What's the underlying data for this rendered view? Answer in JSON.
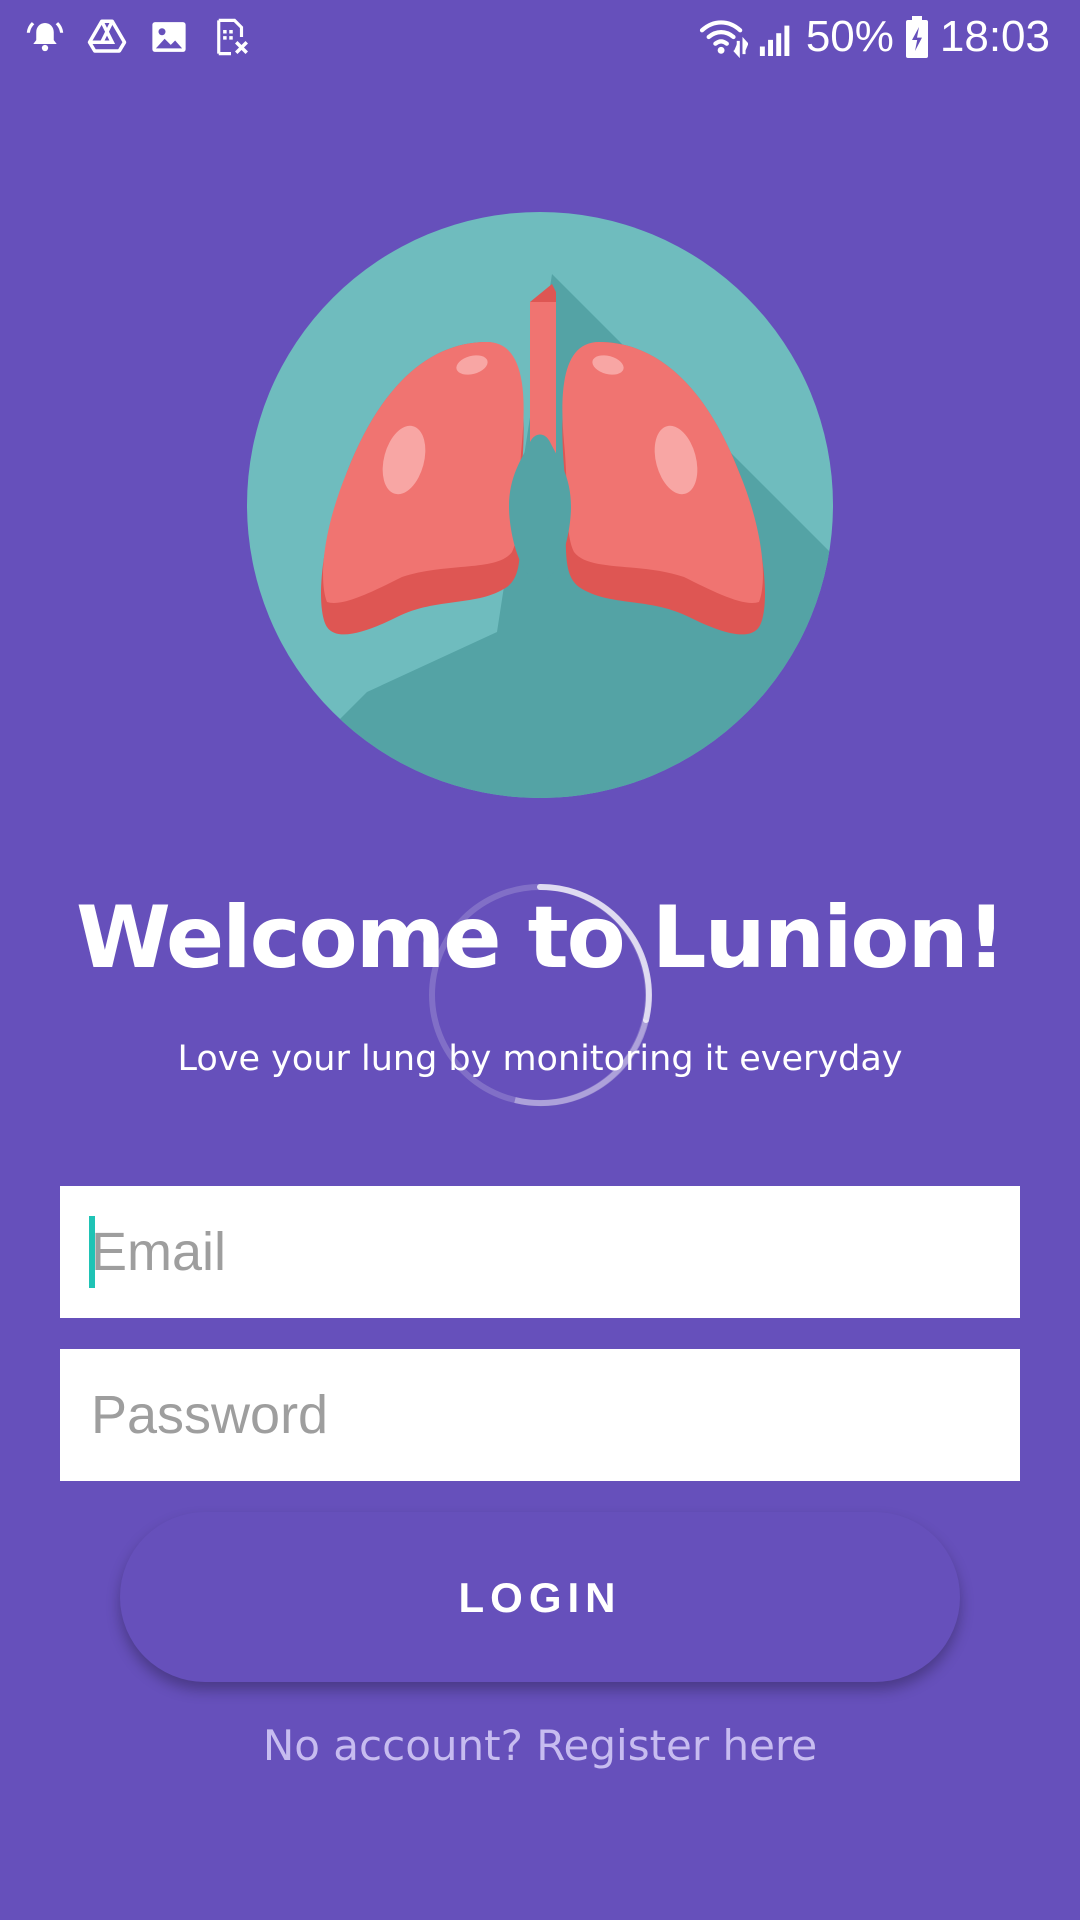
{
  "status_bar": {
    "battery_percent": "50%",
    "time": "18:03",
    "icons_left": [
      "alarm-icon",
      "drive-icon",
      "gallery-icon",
      "sim-blocked-icon"
    ],
    "icons_right": [
      "wifi-icon",
      "signal-icon",
      "battery-icon"
    ]
  },
  "logo": {
    "icon": "lungs-icon",
    "colors": {
      "circle": "#6FBCBE",
      "shadow": "#54A3A5",
      "lung": "#F07471",
      "lung_shade": "#DE5653",
      "highlight": "#F8A6A4"
    }
  },
  "welcome": {
    "title": "Welcome to Lunion!",
    "subtitle": "Love your lung by monitoring it everyday"
  },
  "form": {
    "email_placeholder": "Email",
    "password_placeholder": "Password",
    "login_label": "LOGIN",
    "register_text": "No account? Register here"
  },
  "colors": {
    "background": "#6650BB",
    "accent_cursor": "#1FC3B5",
    "link": "#C7BCF0"
  }
}
